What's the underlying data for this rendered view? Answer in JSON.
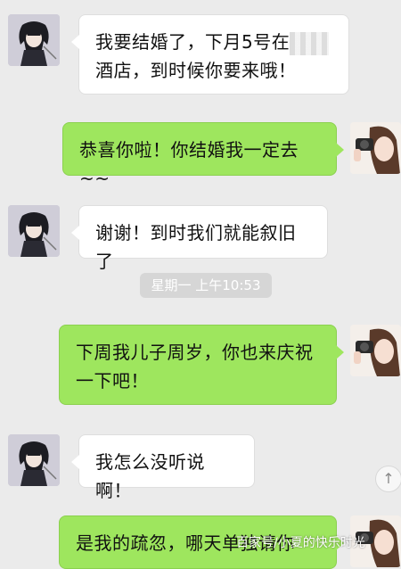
{
  "messages": [
    {
      "side": "left",
      "lines": [
        "我要结婚了，下月5号在",
        "酒店，到时候你要来哦！"
      ],
      "redacted_inline": true
    },
    {
      "side": "right",
      "lines": [
        "恭喜你啦！你结婚我一定去~~"
      ]
    },
    {
      "side": "left",
      "lines": [
        "谢谢！到时我们就能叙旧了"
      ]
    },
    {
      "side": "right",
      "lines": [
        "下周我儿子周岁，你也来庆祝",
        "一下吧！"
      ]
    },
    {
      "side": "left",
      "lines": [
        "我怎么没听说啊！"
      ]
    },
    {
      "side": "right",
      "lines": [
        "是我的疏忽，哪天单独请你"
      ]
    }
  ],
  "timestamp": "星期一 上午10:53",
  "scroll_icon": "arrow-up-icon",
  "scroll_glyph": "↑",
  "watermark": "百家号/小夏的快乐时光",
  "colors": {
    "background": "#ebebeb",
    "incoming_bubble": "#ffffff",
    "outgoing_bubble": "#9ee65e"
  }
}
